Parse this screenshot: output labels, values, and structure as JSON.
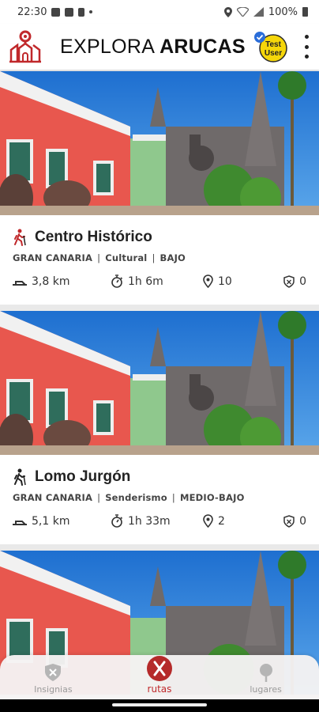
{
  "status": {
    "time": "22:30",
    "battery": "100%"
  },
  "app": {
    "brand_light": "EXPLORA",
    "brand_bold": "ARUCAS",
    "user_line1": "Test",
    "user_line2": "User",
    "accent": "#c0282b"
  },
  "routes": [
    {
      "title": "Centro Histórico",
      "tags": [
        "GRAN CANARIA",
        "Cultural",
        "BAJO"
      ],
      "distance": "3,8 km",
      "duration": "1h 6m",
      "places": "10",
      "badges": "0"
    },
    {
      "title": "Lomo Jurgón",
      "tags": [
        "GRAN CANARIA",
        "Senderismo",
        "MEDIO-BAJO"
      ],
      "distance": "5,1 km",
      "duration": "1h 33m",
      "places": "2",
      "badges": "0"
    }
  ],
  "nav": {
    "insignias": "Insignias",
    "rutas": "rutas",
    "lugares": "lugares"
  }
}
